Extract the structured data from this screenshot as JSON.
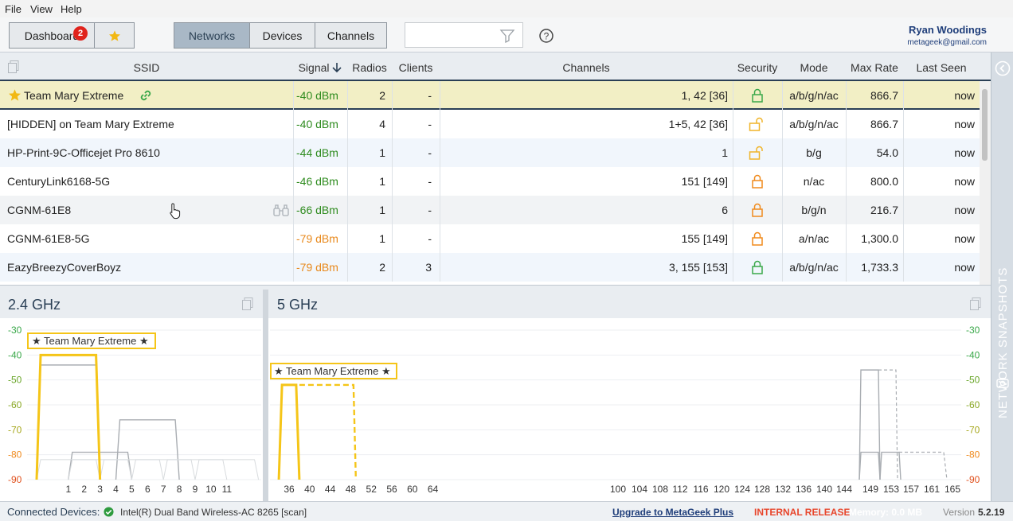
{
  "menu": [
    "File",
    "View",
    "Help"
  ],
  "toolbar": {
    "dashboard_label": "Dashboard",
    "dashboard_badge": "2",
    "tabs": [
      "Networks",
      "Devices",
      "Channels"
    ],
    "active_tab": "Networks",
    "search_value": ""
  },
  "user": {
    "name": "Ryan Woodings",
    "email": "metageek@gmail.com"
  },
  "table": {
    "headers": [
      "SSID",
      "Signal",
      "Radios",
      "Clients",
      "Channels",
      "Security",
      "Mode",
      "Max Rate",
      "Last Seen"
    ],
    "sort_column": "Signal",
    "rows": [
      {
        "ssid": "Team Mary Extreme",
        "signal": "-40 dBm",
        "radios": "2",
        "clients": "-",
        "channels": "1, 42 [36]",
        "security": "open-lock",
        "mode": "a/b/g/n/ac",
        "max_rate": "866.7",
        "last_seen": "now",
        "starred": true,
        "signal_color": "#2e8b1e",
        "security_color": "#3aa84a"
      },
      {
        "ssid": "[HIDDEN] on Team Mary Extreme",
        "signal": "-40 dBm",
        "radios": "4",
        "clients": "-",
        "channels": "1+5, 42 [36]",
        "security": "unlocked",
        "mode": "a/b/g/n/ac",
        "max_rate": "866.7",
        "last_seen": "now",
        "starred": false,
        "signal_color": "#2e8b1e",
        "security_color": "#f0b429"
      },
      {
        "ssid": "HP-Print-9C-Officejet Pro 8610",
        "signal": "-44 dBm",
        "radios": "1",
        "clients": "-",
        "channels": "1",
        "security": "unlocked",
        "mode": "b/g",
        "max_rate": "54.0",
        "last_seen": "now",
        "starred": false,
        "signal_color": "#2e8b1e",
        "security_color": "#f0b429"
      },
      {
        "ssid": "CenturyLink6168-5G",
        "signal": "-46 dBm",
        "radios": "1",
        "clients": "-",
        "channels": "151 [149]",
        "security": "locked",
        "mode": "n/ac",
        "max_rate": "800.0",
        "last_seen": "now",
        "starred": false,
        "signal_color": "#2e8b1e",
        "security_color": "#f08a1c"
      },
      {
        "ssid": "CGNM-61E8",
        "signal": "-66 dBm",
        "radios": "1",
        "clients": "-",
        "channels": "6",
        "security": "locked",
        "mode": "b/g/n",
        "max_rate": "216.7",
        "last_seen": "now",
        "starred": false,
        "signal_color": "#2e8b1e",
        "security_color": "#f08a1c"
      },
      {
        "ssid": "CGNM-61E8-5G",
        "signal": "-79 dBm",
        "radios": "1",
        "clients": "-",
        "channels": "155 [149]",
        "security": "locked",
        "mode": "a/n/ac",
        "max_rate": "1,300.0",
        "last_seen": "now",
        "starred": false,
        "signal_color": "#e8891c",
        "security_color": "#f08a1c"
      },
      {
        "ssid": "EazyBreezyCoverBoyz",
        "signal": "-79 dBm",
        "radios": "2",
        "clients": "3",
        "channels": "3, 155 [153]",
        "security": "locked-green",
        "mode": "a/b/g/n/ac",
        "max_rate": "1,733.3",
        "last_seen": "now",
        "starred": false,
        "signal_color": "#e8891c",
        "security_color": "#3aa84a"
      }
    ]
  },
  "snapshots_label": "NETWORK SNAPSHOTS",
  "graph24": {
    "title": "2.4 GHz",
    "highlight_label": "★ Team Mary Extreme ★",
    "y_ticks": [
      "-30",
      "-40",
      "-50",
      "-60",
      "-70",
      "-80",
      "-90"
    ],
    "x_ticks": [
      "1",
      "2",
      "3",
      "4",
      "5",
      "6",
      "7",
      "8",
      "9",
      "10",
      "11"
    ]
  },
  "graph5": {
    "title": "5 GHz",
    "highlight_label": "★ Team Mary Extreme ★",
    "y_ticks": [
      "-30",
      "-40",
      "-50",
      "-60",
      "-70",
      "-80",
      "-90"
    ],
    "x_ticks_low": [
      "36",
      "40",
      "44",
      "48",
      "52",
      "56",
      "60",
      "64"
    ],
    "x_ticks_high": [
      "100",
      "104",
      "108",
      "112",
      "116",
      "120",
      "124",
      "128",
      "132",
      "136",
      "140",
      "144",
      "149",
      "153",
      "157",
      "161",
      "165"
    ]
  },
  "chart_data": [
    {
      "type": "area",
      "title": "2.4 GHz",
      "xlabel": "",
      "ylabel": "",
      "ylim": [
        -90,
        -30
      ],
      "x_ticks": [
        1,
        2,
        3,
        4,
        5,
        6,
        7,
        8,
        9,
        10,
        11
      ],
      "series": [
        {
          "name": "Team Mary Extreme",
          "channel": 1,
          "signal": -40
        },
        {
          "channel": 1,
          "signal": -40
        },
        {
          "channel": 1,
          "signal": -44
        },
        {
          "channel": 6,
          "signal": -66
        },
        {
          "channel": 3,
          "signal": -79
        }
      ]
    },
    {
      "type": "area",
      "title": "5 GHz",
      "xlabel": "",
      "ylabel": "",
      "ylim": [
        -90,
        -30
      ],
      "series": [
        {
          "name": "Team Mary Extreme",
          "channel": 36,
          "signal": -40
        },
        {
          "channel": 42,
          "signal": -40
        },
        {
          "channel": 149,
          "signal": -46
        },
        {
          "channel": 155,
          "signal": -79
        },
        {
          "channel": 153,
          "signal": -79
        }
      ]
    }
  ],
  "status": {
    "connected_label": "Connected Devices:",
    "adapter": "Intel(R) Dual Band Wireless-AC 8265 [scan]",
    "upgrade_link": "Upgrade to MetaGeek Plus",
    "release": "INTERNAL RELEASE",
    "memory": "Memory: 0.0 MB",
    "version_label": "Version",
    "version": "5.2.19"
  }
}
